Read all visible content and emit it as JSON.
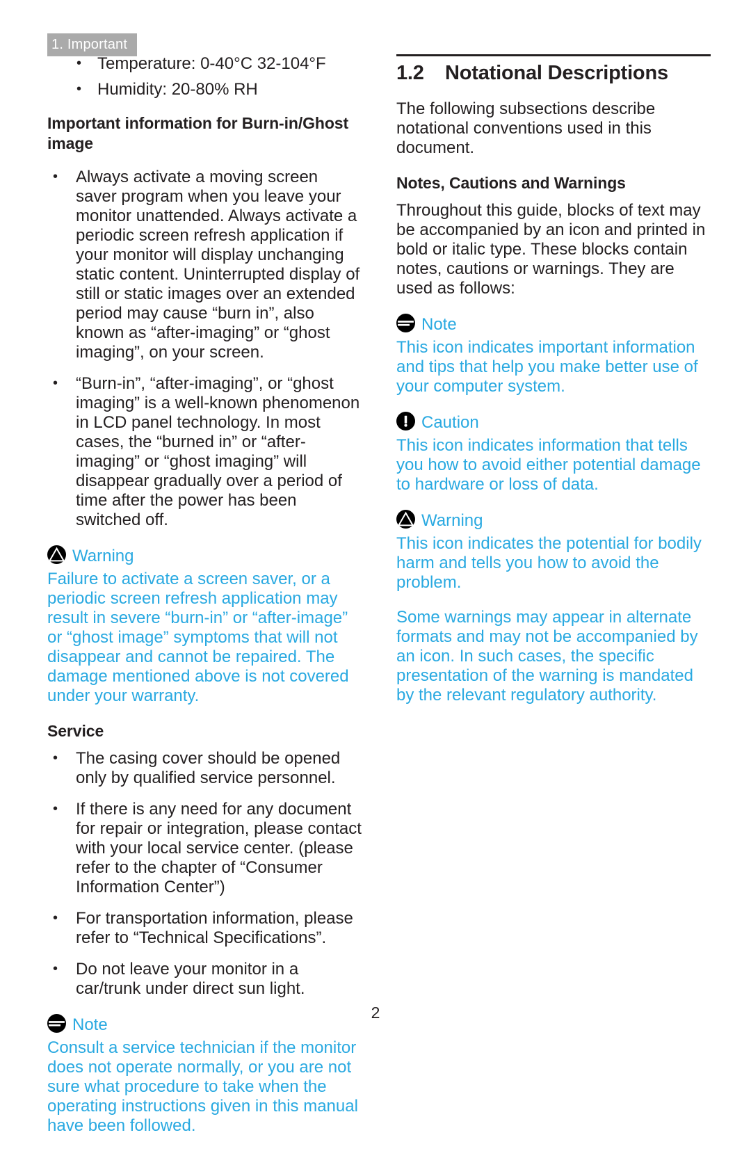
{
  "header": {
    "tab_label": "1. Important"
  },
  "left_column": {
    "env_bullets": [
      "Temperature: 0-40°C 32-104°F",
      "Humidity: 20-80% RH"
    ],
    "burnin_heading": "Important information for Burn-in/Ghost image",
    "burnin_bullets": [
      "Always activate a moving screen saver program when you leave your monitor unattended. Always activate a periodic screen refresh application if your monitor will display unchanging static content. Uninterrupted display of still or static images over an extended period may cause “burn in”, also known as “after-imaging” or “ghost imaging”, on your screen.",
      "“Burn-in”, “after-imaging”, or “ghost imaging” is a well-known phenomenon in LCD panel technology. In most cases, the “burned in” or “after-imaging” or “ghost imaging” will disappear gradually over a period of time after the power has been switched off."
    ],
    "warning": {
      "icon": "warning-triangle-icon",
      "title": "Warning",
      "body": "Failure to activate a screen saver, or a periodic screen refresh application may result in severe “burn-in” or “after-image” or “ghost image” symptoms that will not disappear and cannot be repaired. The damage mentioned above is not covered under your warranty."
    },
    "service_heading": "Service",
    "service_bullets": [
      "The casing cover should be opened only by qualified service personnel.",
      "If there is any need for any document for repair or integration, please contact with your local service center. (please refer to the chapter of “Consumer Information Center”)",
      "For transportation information, please refer to “Technical Specifications”.",
      "Do not leave your monitor in a car/trunk under direct sun light."
    ],
    "note": {
      "icon": "note-lines-icon",
      "title": "Note",
      "body": "Consult a service technician if the monitor does not operate normally, or you are not sure what procedure to take when the operating instructions given in this manual have been followed."
    }
  },
  "right_column": {
    "section_number": "1.2",
    "section_title": "Notational Descriptions",
    "intro": "The following subsections describe notational conventions used in this document.",
    "subheading": "Notes, Cautions and Warnings",
    "subintro": "Throughout this guide, blocks of text may be accompanied by an icon and printed in bold or italic type. These blocks contain notes, cautions or warnings. They are used as follows:",
    "note": {
      "icon": "note-lines-icon",
      "title": "Note",
      "body": "This icon indicates important information and tips that help you make better use of your computer system."
    },
    "caution": {
      "icon": "caution-exclamation-icon",
      "title": "Caution",
      "body": "This icon indicates information that tells you how to avoid either potential damage to hardware or loss of data."
    },
    "warning": {
      "icon": "warning-triangle-icon",
      "title": "Warning",
      "body": "This icon indicates the potential for bodily harm and tells you how to avoid the problem.",
      "body2": "Some warnings may appear in alternate formats and may not be accompanied by an icon. In such cases, the specific presentation of the warning is mandated by the relevant regulatory authority."
    }
  },
  "footer": {
    "page_number": "2"
  },
  "colors": {
    "accent_blue": "#29a9e1",
    "text_black": "#231f20",
    "tab_gray": "#aaaaaa"
  }
}
